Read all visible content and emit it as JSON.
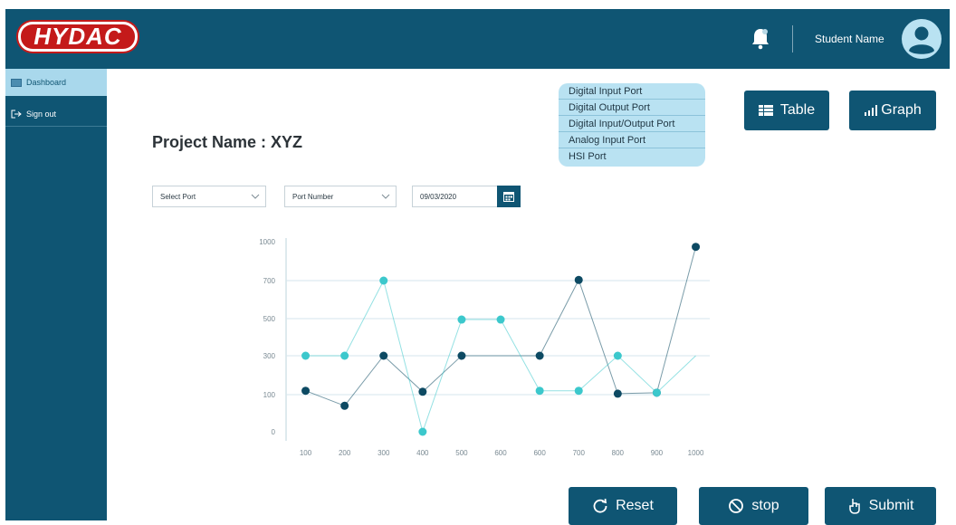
{
  "header": {
    "logo_text": "HYDAC",
    "username": "Student Name",
    "icons": [
      "bell-icon",
      "user-avatar-icon"
    ]
  },
  "sidebar": {
    "items": [
      {
        "label": "Dashboard",
        "icon": "dashboard-icon",
        "active": true
      },
      {
        "label": "Sign out",
        "icon": "sign-out-icon",
        "active": false
      }
    ]
  },
  "main": {
    "project_title": "Project Name : XYZ",
    "port_types": [
      "Digital Input Port",
      "Digital Output Port",
      "Digital Input/Output Port",
      "Analog Input Port",
      "HSI Port"
    ],
    "view_buttons": {
      "table": "Table",
      "graph": "Graph"
    },
    "filters": {
      "port_select": "Select Port",
      "port_number": "Port Number",
      "date": "09/03/2020"
    },
    "actions": {
      "reset": "Reset",
      "stop": "stop",
      "submit": "Submit"
    }
  },
  "colors": {
    "primary": "#0f5573",
    "accent_light": "#b9e2f2",
    "series_dark": "#0d4a63",
    "series_light": "#3cc8cc"
  },
  "chart_data": {
    "type": "line",
    "categories": [
      "100",
      "200",
      "300",
      "400",
      "500",
      "600",
      "600",
      "700",
      "800",
      "900",
      "1000"
    ],
    "y_ticks": [
      "0",
      "100",
      "300",
      "500",
      "700",
      "1000"
    ],
    "grid": true,
    "series": [
      {
        "color": "#0d4a63",
        "points": [
          [
            0.5,
            120
          ],
          [
            1.5,
            70
          ],
          [
            2.5,
            300
          ],
          [
            3.5,
            115
          ],
          [
            4.5,
            300
          ],
          [
            6.5,
            300
          ],
          [
            7.5,
            705
          ],
          [
            8.5,
            105
          ],
          [
            9.5,
            110
          ],
          [
            10.5,
            960
          ]
        ]
      },
      {
        "color": "#3cc8cc",
        "points": [
          [
            0.5,
            300
          ],
          [
            1.5,
            300
          ],
          [
            2.5,
            700
          ],
          [
            3.5,
            0
          ],
          [
            4.5,
            495
          ],
          [
            5.5,
            495
          ],
          [
            6.5,
            120
          ],
          [
            7.5,
            120
          ],
          [
            8.5,
            300
          ],
          [
            9.5,
            110
          ],
          [
            10.5,
            300
          ]
        ]
      }
    ]
  }
}
